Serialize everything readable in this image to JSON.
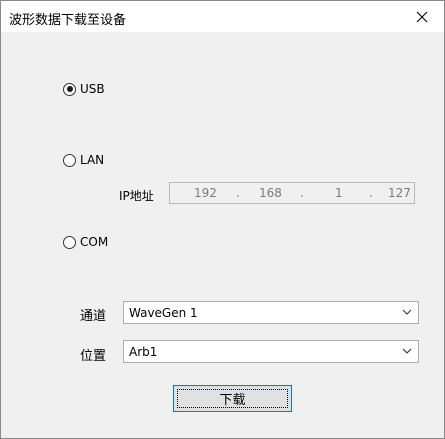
{
  "window": {
    "title": "波形数据下载至设备",
    "close_glyph": "✕"
  },
  "connection": {
    "options": [
      {
        "label": "USB",
        "selected": true
      },
      {
        "label": "LAN",
        "selected": false
      },
      {
        "label": "COM",
        "selected": false
      }
    ],
    "ip_label": "IP地址",
    "ip_octets": [
      "192",
      "168",
      "1",
      "127"
    ],
    "ip_separator": "."
  },
  "channel": {
    "label": "通道",
    "value": "WaveGen 1"
  },
  "location": {
    "label": "位置",
    "value": "Arb1"
  },
  "actions": {
    "download_label": "下载"
  },
  "colors": {
    "accent_border": "#0078d7",
    "dialog_bg": "#f0f0f0",
    "disabled_text": "#7a7a7a"
  }
}
